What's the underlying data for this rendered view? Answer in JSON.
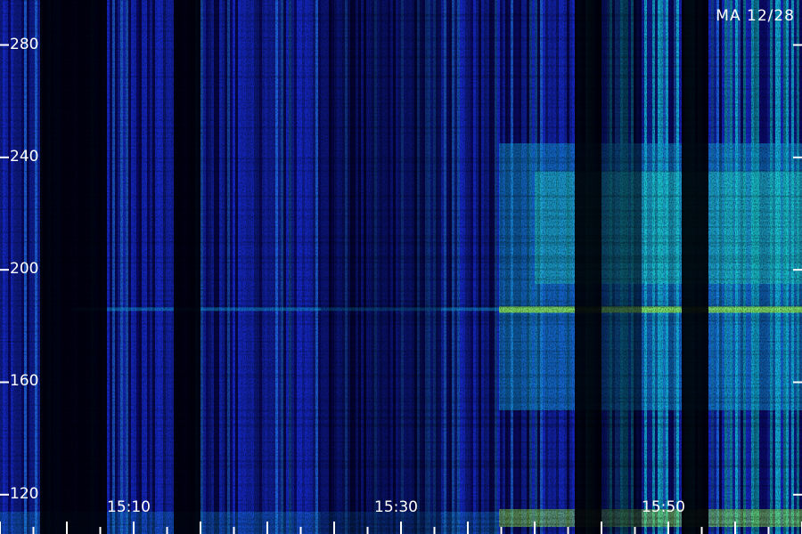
{
  "header": {
    "station_label": "MA 12/28"
  },
  "colors": {
    "background": "#000000",
    "axis": "#ffffff",
    "palette": [
      "#000010",
      "#0a0a6e",
      "#1428c8",
      "#1e64e6",
      "#14b4e6",
      "#28f0c8",
      "#a0ff50"
    ]
  },
  "chart_data": {
    "type": "heatmap",
    "title": "",
    "xlabel": "",
    "ylabel": "",
    "x_ticks": [
      "15:10",
      "15:30",
      "15:50"
    ],
    "y_ticks": [
      120,
      160,
      200,
      240,
      280
    ],
    "y_range": [
      106,
      296
    ],
    "x_range": [
      "15:05",
      "15:55"
    ],
    "grid": false,
    "dark_bands_time": [
      [
        "15:03",
        "15:08"
      ],
      [
        "15:13",
        "15:15"
      ],
      [
        "15:43",
        "15:45"
      ],
      [
        "15:51",
        "15:53"
      ]
    ],
    "bright_line_frequency": 186,
    "intensity_trend": "increasing toward later times, strongest near 186 and 200-230"
  }
}
